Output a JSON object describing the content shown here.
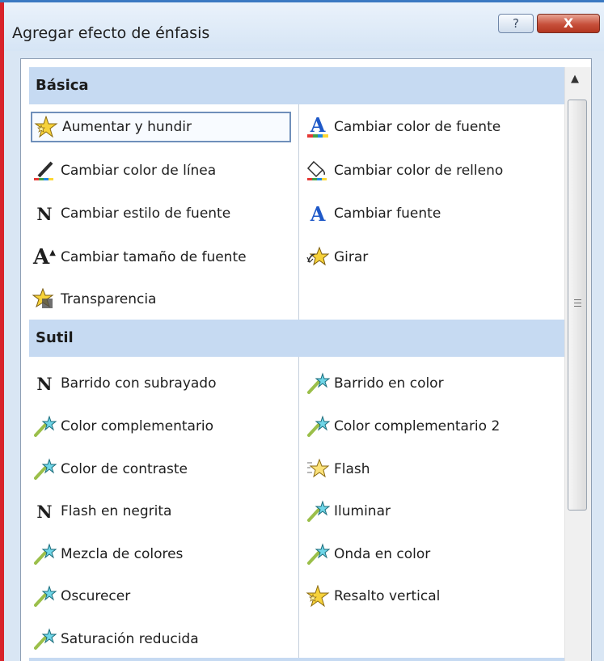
{
  "window": {
    "title": "Agregar efecto de énfasis",
    "help_label": "?",
    "close_label": "X"
  },
  "groups": [
    {
      "name": "Básica",
      "left": [
        {
          "label": "Aumentar y hundir",
          "icon": "star-burst-icon"
        },
        {
          "label": "Cambiar color de línea",
          "icon": "pen-color-icon"
        },
        {
          "label": "Cambiar estilo de fuente",
          "icon": "bold-n-icon",
          "glyph": "N"
        },
        {
          "label": "Cambiar tamaño de fuente",
          "icon": "font-size-icon",
          "glyph": "A"
        },
        {
          "label": "Transparencia",
          "icon": "transparency-star-icon"
        }
      ],
      "right": [
        {
          "label": "Cambiar color de fuente",
          "icon": "font-color-icon",
          "glyph": "A"
        },
        {
          "label": "Cambiar color de relleno",
          "icon": "fill-bucket-icon"
        },
        {
          "label": "Cambiar fuente",
          "icon": "font-a-icon",
          "glyph": "A"
        },
        {
          "label": "Girar",
          "icon": "spin-star-icon"
        }
      ]
    },
    {
      "name": "Sutil",
      "left": [
        {
          "label": "Barrido con subrayado",
          "icon": "bold-n-icon",
          "glyph": "N"
        },
        {
          "label": "Color complementario",
          "icon": "wand-star-icon"
        },
        {
          "label": "Color de contraste",
          "icon": "wand-star-icon"
        },
        {
          "label": "Flash en negrita",
          "icon": "bold-n-icon",
          "glyph": "N"
        },
        {
          "label": "Mezcla de colores",
          "icon": "wand-star-icon"
        },
        {
          "label": "Oscurecer",
          "icon": "wand-star-icon"
        },
        {
          "label": "Saturación reducida",
          "icon": "wand-star-icon"
        }
      ],
      "right": [
        {
          "label": "Barrido en color",
          "icon": "wand-star-icon"
        },
        {
          "label": "Color complementario 2",
          "icon": "wand-star-icon"
        },
        {
          "label": "Flash",
          "icon": "flash-star-icon"
        },
        {
          "label": "Iluminar",
          "icon": "wand-star-icon"
        },
        {
          "label": "Onda en color",
          "icon": "wand-star-icon"
        },
        {
          "label": "Resalto vertical",
          "icon": "star-burst-icon"
        }
      ]
    }
  ],
  "colors": {
    "header_bg": "#c6daf2",
    "accent_blue": "#1f59c8",
    "close_red": "#c7503b"
  }
}
